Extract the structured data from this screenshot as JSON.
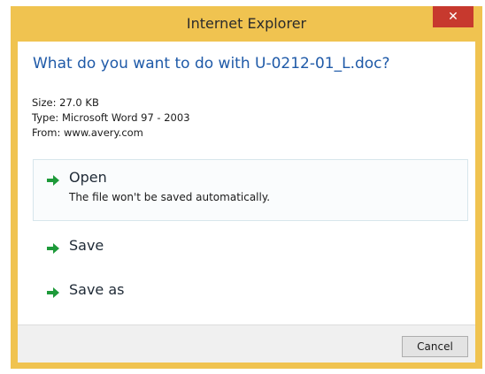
{
  "window": {
    "title": "Internet Explorer",
    "close_label": "✕"
  },
  "dialog": {
    "question": "What do you want to do with U-0212-01_L.doc?",
    "size_line": "Size: 27.0 KB",
    "type_line": "Type: Microsoft Word 97 - 2003",
    "from_line": "From: www.avery.com"
  },
  "options": {
    "open": {
      "label": "Open",
      "sublabel": "The file won't be saved automatically."
    },
    "save": {
      "label": "Save"
    },
    "save_as": {
      "label": "Save as"
    }
  },
  "footer": {
    "cancel_label": "Cancel"
  },
  "colors": {
    "frame": "#f0c350",
    "close_button": "#c7392e",
    "question_text": "#1f5aa8",
    "arrow": "#1e9a3a"
  },
  "icons": {
    "arrow": "green-arrow-right-icon"
  }
}
